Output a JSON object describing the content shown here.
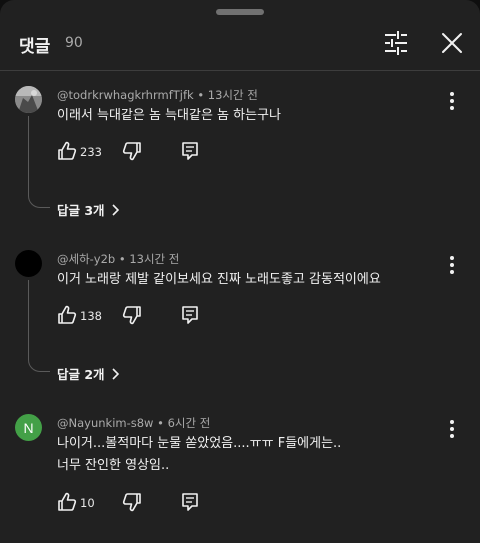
{
  "header": {
    "title": "댓글",
    "count": "90"
  },
  "comments": [
    {
      "author": "@todrkrwhagkrhrmfTjfk",
      "time": "13시간 전",
      "lines": [
        "이래서 늑대같은 놈 늑대같은 놈 하는구나"
      ],
      "likes": "233",
      "replies_label": "답글 3개",
      "avatar": "photo-avatar"
    },
    {
      "author": "@세하-y2b",
      "time": "13시간 전",
      "lines": [
        "이거 노래랑 제발 같이보세요 진짜 노래도좋고 감동적이에요"
      ],
      "likes": "138",
      "replies_label": "답글 2개",
      "avatar": "black-avatar"
    },
    {
      "author": "@Nayunkim-s8w",
      "time": "6시간 전",
      "lines": [
        "나이거...볼적마다 눈물 쏟았었음....ㅠㅠ F들에게는..",
        "너무 잔인한 영상임.."
      ],
      "likes": "10",
      "avatar_letter": "N",
      "avatar_color": "#43a047"
    }
  ],
  "colors": {
    "panel_bg": "#212121",
    "text_primary": "#f1f1f1",
    "text_secondary": "#aaaaaa",
    "avatar_green": "#43a047"
  },
  "icons": {
    "filter": "sliders-icon",
    "close": "close-icon",
    "more": "more-vertical-icon",
    "like": "thumbs-up-icon",
    "dislike": "thumbs-down-icon",
    "reply": "reply-comment-icon",
    "chevron": "chevron-right-icon"
  }
}
